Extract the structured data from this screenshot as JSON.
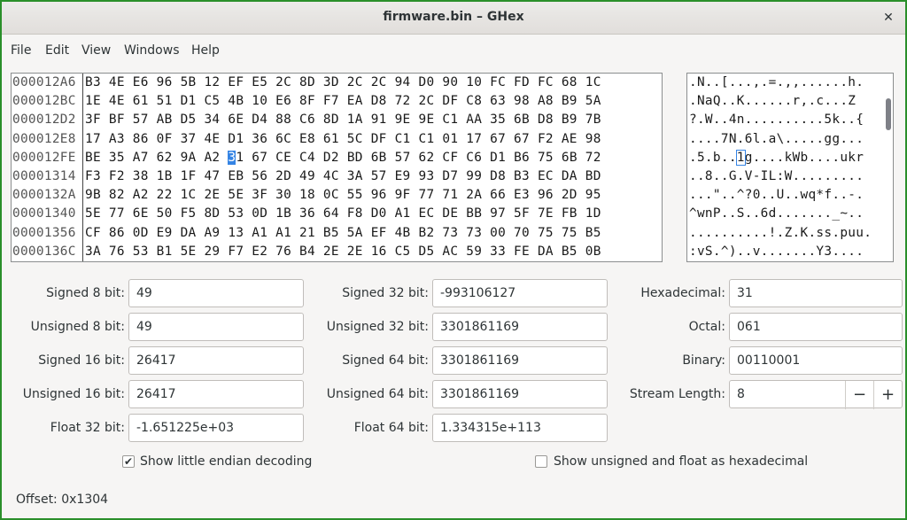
{
  "window": {
    "title": "firmware.bin – GHex",
    "close_glyph": "✕"
  },
  "menu": [
    "File",
    "Edit",
    "View",
    "Windows",
    "Help"
  ],
  "hex_view": {
    "offsets": [
      "000012A6",
      "000012BC",
      "000012D2",
      "000012E8",
      "000012FE",
      "00001314",
      "0000132A",
      "00001340",
      "00001356",
      "0000136C"
    ],
    "hex_rows": [
      "B3 4E E6 96 5B 12 EF E5 2C 8D 3D 2C 2C 94 D0 90 10 FC FD FC 68 1C",
      "1E 4E 61 51 D1 C5 4B 10 E6 8F F7 EA D8 72 2C DF C8 63 98 A8 B9 5A",
      "3F BF 57 AB D5 34 6E D4 88 C6 8D 1A 91 9E 9E C1 AA 35 6B D8 B9 7B",
      "17 A3 86 0F 37 4E D1 36 6C E8 61 5C DF C1 C1 01 17 67 67 F2 AE 98",
      "BE 35 A7 62 9A A2 31 67 CE C4 D2 BD 6B 57 62 CF C6 D1 B6 75 6B 72",
      "F3 F2 38 1B 1F 47 EB 56 2D 49 4C 3A 57 E9 93 D7 99 D8 B3 EC DA BD",
      "9B 82 A2 22 1C 2E 5E 3F 30 18 0C 55 96 9F 77 71 2A 66 E3 96 2D 95",
      "5E 77 6E 50 F5 8D 53 0D 1B 36 64 F8 D0 A1 EC DE BB 97 5F 7E FB 1D",
      "CF 86 0D E9 DA A9 13 A1 A1 21 B5 5A EF 4B B2 73 73 00 70 75 75 B5",
      "3A 76 53 B1 5E 29 F7 E2 76 B4 2E 2E 16 C5 D5 AC 59 33 FE DA B5 0B"
    ],
    "hex_selected_before": "BE 35 A7 62 9A A2 ",
    "hex_selected_byte": "3",
    "hex_selected_rest": "1",
    "hex_selected_after": " 67 CE C4 D2 BD 6B 57 62 CF C6 D1 B6 75 6B 72",
    "ascii_rows": [
      ".N..[...,.=.,,......h.",
      ".NaQ..K......r,.c...Z",
      "?.W..4n..........5k..{",
      "....7N.6l.a\\.....gg...",
      ".5.b..1g....kWb....ukr",
      "..8..G.V-IL:W.........",
      "...\"..^?0..U..wq*f..-.",
      "^wnP..S..6d......._~..",
      "..........!.Z.K.ss.puu.",
      ":vS.^)..v.......Y3...."
    ],
    "ascii_selected_before": ".5.b..",
    "ascii_selected_char": "1",
    "ascii_selected_after": "g....kWb....ukr",
    "selection_color": "#3584e4"
  },
  "fields": {
    "signed8": {
      "label": "Signed 8 bit:",
      "value": "49"
    },
    "unsigned8": {
      "label": "Unsigned 8 bit:",
      "value": "49"
    },
    "signed16": {
      "label": "Signed 16 bit:",
      "value": "26417"
    },
    "unsigned16": {
      "label": "Unsigned 16 bit:",
      "value": "26417"
    },
    "float32": {
      "label": "Float 32 bit:",
      "value": "-1.651225e+03"
    },
    "signed32": {
      "label": "Signed 32 bit:",
      "value": "-993106127"
    },
    "unsigned32": {
      "label": "Unsigned 32 bit:",
      "value": "3301861169"
    },
    "signed64": {
      "label": "Signed 64 bit:",
      "value": "3301861169"
    },
    "unsigned64": {
      "label": "Unsigned 64 bit:",
      "value": "3301861169"
    },
    "float64": {
      "label": "Float 64 bit:",
      "value": "1.334315e+113"
    },
    "hexadecimal": {
      "label": "Hexadecimal:",
      "value": "31"
    },
    "octal": {
      "label": "Octal:",
      "value": "061"
    },
    "binary": {
      "label": "Binary:",
      "value": "00110001"
    },
    "stream_length": {
      "label": "Stream Length:",
      "value": "8",
      "minus": "−",
      "plus": "+"
    }
  },
  "options": {
    "little_endian": {
      "label": "Show little endian decoding",
      "checked": true,
      "mark": "✔"
    },
    "unsigned_hex": {
      "label": "Show unsigned and float as hexadecimal",
      "checked": false
    }
  },
  "status": {
    "offset": "Offset: 0x1304"
  },
  "accent_border": "#2a8f2a"
}
